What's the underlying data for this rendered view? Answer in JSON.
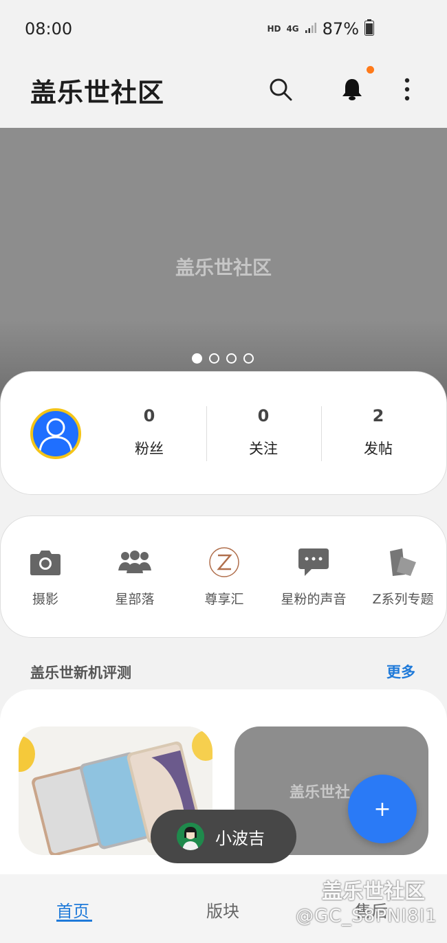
{
  "status": {
    "time": "08:00",
    "hd": "HD",
    "network": "4G",
    "battery": "87%"
  },
  "app": {
    "title": "盖乐世社区"
  },
  "banner": {
    "text": "盖乐世社区",
    "pages": 4,
    "active_page": 1
  },
  "profile": {
    "stats": [
      {
        "value": "0",
        "label": "粉丝"
      },
      {
        "value": "0",
        "label": "关注"
      },
      {
        "value": "2",
        "label": "发帖"
      }
    ]
  },
  "shortcuts": [
    {
      "label": "摄影",
      "icon": "camera-icon"
    },
    {
      "label": "星部落",
      "icon": "group-icon"
    },
    {
      "label": "尊享汇",
      "icon": "z-premier-icon"
    },
    {
      "label": "星粉的声音",
      "icon": "chat-bubble-icon"
    },
    {
      "label": "Z系列专题",
      "icon": "z-series-icon"
    }
  ],
  "section": {
    "title": "盖乐世新机评测",
    "more": "更多"
  },
  "review": {
    "placeholder_text": "盖乐世社",
    "caption": ""
  },
  "toast": {
    "text": "小波吉"
  },
  "nav": {
    "home": "首页",
    "boards": "版块",
    "aftersales": "售后"
  },
  "watermark": {
    "line1": "盖乐世社区",
    "line2": "@GC_S8PNI8I1"
  },
  "colors": {
    "accent": "#1f7ad9",
    "fab": "#2a7af6",
    "notification_dot": "#ff7a1a",
    "avatar_ring": "#f4c418"
  }
}
